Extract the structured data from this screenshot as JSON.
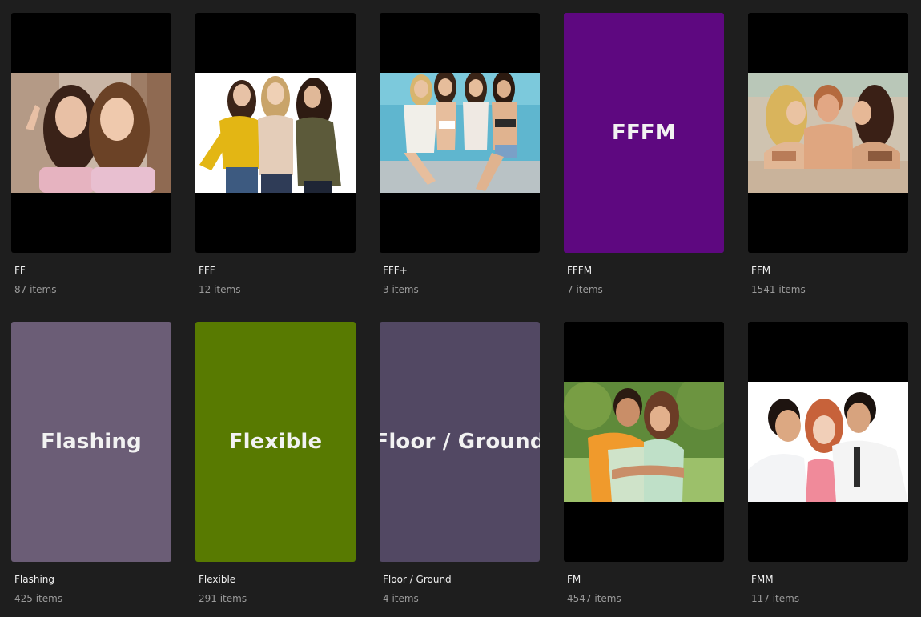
{
  "collections": [
    {
      "title": "FF",
      "count": "87 items",
      "thumbnail": "photo",
      "image_subject": "two-women-selfie-photo"
    },
    {
      "title": "FFF",
      "count": "12 items",
      "thumbnail": "photo",
      "image_subject": "three-women-studio-photo"
    },
    {
      "title": "FFF+",
      "count": "3 items",
      "thumbnail": "photo",
      "image_subject": "four-women-poolside-photo"
    },
    {
      "title": "FFFM",
      "count": "7 items",
      "thumbnail": "color",
      "cover_text": "FFFM",
      "cover_color": "#5e0880"
    },
    {
      "title": "FFM",
      "count": "1541 items",
      "thumbnail": "photo",
      "image_subject": "hot-tub-trio-photo"
    },
    {
      "title": "Flashing",
      "count": "425 items",
      "thumbnail": "color",
      "cover_text": "Flashing",
      "cover_color": "#6b5d76"
    },
    {
      "title": "Flexible",
      "count": "291 items",
      "thumbnail": "color",
      "cover_text": "Flexible",
      "cover_color": "#587a01"
    },
    {
      "title": "Floor / Ground",
      "count": "4 items",
      "thumbnail": "color",
      "cover_text": "Floor / Ground",
      "cover_color": "#524863"
    },
    {
      "title": "FM",
      "count": "4547 items",
      "thumbnail": "photo",
      "image_subject": "couple-embrace-park-photo"
    },
    {
      "title": "FMM",
      "count": "117 items",
      "thumbnail": "photo",
      "image_subject": "two-men-one-woman-photo"
    }
  ]
}
